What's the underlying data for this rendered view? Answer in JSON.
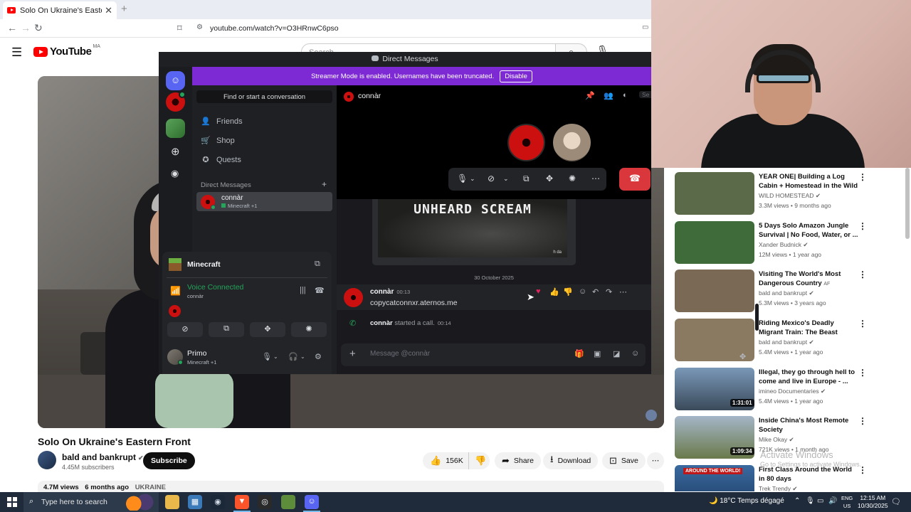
{
  "browser": {
    "tab_title": "Solo On Ukraine's Eastern Front",
    "new_tab": "+",
    "url": "youtube.com/watch?v=O3HRnwC6pso"
  },
  "youtube": {
    "logo_text": "YouTube",
    "country_code": "MA",
    "search_placeholder": "Search",
    "video": {
      "title": "Solo On Ukraine's Eastern Front",
      "channel": "bald and bankrupt",
      "subscribers": "4.45M subscribers",
      "subscribe_label": "Subscribe",
      "likes": "156K",
      "share_label": "Share",
      "download_label": "Download",
      "save_label": "Save",
      "views": "4.7M views",
      "age": "6 months ago",
      "tag": "UKRAINE"
    },
    "recommendations": [
      {
        "title": "YEAR ONE| Building a Log Cabin + Homestead in the Wild",
        "channel": "WILD HOMESTEAD",
        "meta": "3.3M views • 9 months ago",
        "duration": "",
        "thumb_color": "#5b6b4a"
      },
      {
        "title": "5 Days Solo Amazon Jungle Survival | No Food, Water, or ...",
        "channel": "Xander Budnick",
        "meta": "12M views • 1 year ago",
        "duration": "",
        "thumb_color": "#3f6b3a"
      },
      {
        "title": "Visiting The World's Most Dangerous Country",
        "channel": "bald and bankrupt",
        "meta": "5.3M views • 3 years ago",
        "duration": "",
        "thumb_color": "#7a6a55",
        "badge": "AF"
      },
      {
        "title": "Riding Mexico's Deadly Migrant Train: The Beast",
        "channel": "bald and bankrupt",
        "meta": "5.4M views • 1 year ago",
        "duration": "",
        "thumb_color": "#8a7a62"
      },
      {
        "title": "Illegal, they go through hell to come and live in Europe - ...",
        "channel": "imineo Documentaries",
        "meta": "5.4M views • 1 year ago",
        "duration": "1:31:01",
        "thumb_color": "#4a5a6a"
      },
      {
        "title": "Inside China's Most Remote Society",
        "channel": "Mike Okay",
        "meta": "721K views • 1 month ago",
        "duration": "1:09:34",
        "thumb_color": "#8a9a6a"
      },
      {
        "title": "First Class Around the World in 80 days",
        "channel": "Trek Trendy",
        "meta": "",
        "duration": "",
        "thumb_color": "#3a6aa0",
        "thumb_label": "AROUND THE WORLD!"
      }
    ],
    "watermark": {
      "line1": "Activate Windows",
      "line2": "Go to Settings to activate Windows."
    }
  },
  "discord": {
    "window_title": "Direct Messages",
    "banner_text": "Streamer Mode is enabled. Usernames have been truncated.",
    "banner_button": "Disable",
    "find_conversation": "Find or start a conversation",
    "nav": [
      {
        "label": "Friends",
        "icon": "friends-icon"
      },
      {
        "label": "Shop",
        "icon": "shop-icon"
      },
      {
        "label": "Quests",
        "icon": "quests-icon"
      }
    ],
    "dm_heading": "Direct Messages",
    "dm": {
      "name": "connàr",
      "activity": "Minecraft +1"
    },
    "voice": {
      "server": "Minecraft",
      "status": "Voice Connected",
      "user": "connàr"
    },
    "me": {
      "name": "Primo",
      "activity": "Minecraft +1"
    },
    "channel": {
      "name": "connàr"
    },
    "header_search": "Se",
    "embed_title": "UNHEARD SCREAM",
    "embed_corner": "h da",
    "date_divider": "30 October 2025",
    "message": {
      "author": "connàr",
      "time": "00:13",
      "text": "copycatconnxr.aternos.me"
    },
    "system": {
      "author": "connàr",
      "text": "started a call.",
      "time": "00:14"
    },
    "composer_placeholder": "Message @connàr"
  },
  "taskbar": {
    "search_text": "Type here to search",
    "weather": "18°C  Temps dégagé",
    "lang_line1": "ENG",
    "lang_line2": "US",
    "time": "12:15 AM",
    "date": "10/30/2025"
  },
  "colors": {
    "youtube_red": "#ff0000",
    "discord_blurple": "#5865f2",
    "discord_banner": "#7d2ad5",
    "discord_green": "#23a55a",
    "discord_red": "#da373c",
    "taskbar": "#1f2b3b"
  }
}
